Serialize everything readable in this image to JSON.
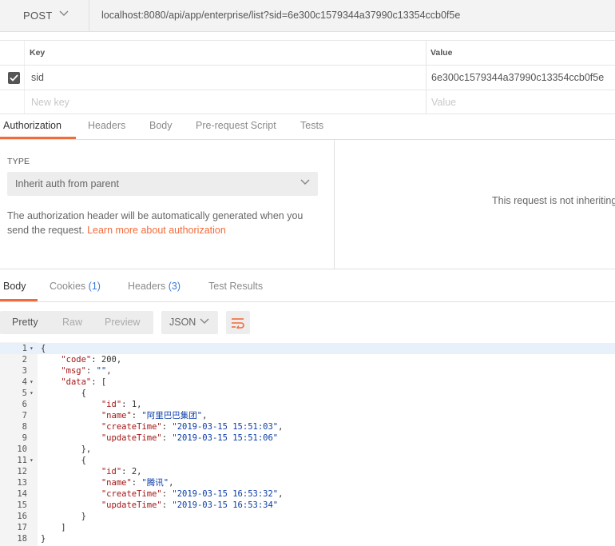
{
  "request": {
    "method": "POST",
    "url": "localhost:8080/api/app/enterprise/list?sid=6e300c1579344a37990c13354ccb0f5e"
  },
  "params": {
    "headers": {
      "key": "Key",
      "value": "Value"
    },
    "rows": [
      {
        "key": "sid",
        "value": "6e300c1579344a37990c13354ccb0f5e",
        "checked": true
      }
    ],
    "new_key_placeholder": "New key",
    "new_value_placeholder": "Value"
  },
  "request_tabs": [
    "Authorization",
    "Headers",
    "Body",
    "Pre-request Script",
    "Tests"
  ],
  "auth": {
    "type_label": "TYPE",
    "type_value": "Inherit auth from parent",
    "description": "The authorization header will be automatically generated when you send the request. ",
    "link_text": "Learn more about authorization",
    "right_message": "This request is not inheriting"
  },
  "response_tabs": {
    "body": "Body",
    "cookies": "Cookies",
    "cookies_count": "(1)",
    "headers": "Headers",
    "headers_count": "(3)",
    "test_results": "Test Results"
  },
  "view_modes": [
    "Pretty",
    "Raw",
    "Preview"
  ],
  "format": "JSON",
  "code_lines": [
    {
      "n": "1",
      "fold": true,
      "text": "{"
    },
    {
      "n": "2",
      "text": "    \"code\": 200,"
    },
    {
      "n": "3",
      "text": "    \"msg\": \"\","
    },
    {
      "n": "4",
      "fold": true,
      "text": "    \"data\": ["
    },
    {
      "n": "5",
      "fold": true,
      "text": "        {"
    },
    {
      "n": "6",
      "text": "            \"id\": 1,"
    },
    {
      "n": "7",
      "text": "            \"name\": \"阿里巴巴集团\","
    },
    {
      "n": "8",
      "text": "            \"createTime\": \"2019-03-15 15:51:03\","
    },
    {
      "n": "9",
      "text": "            \"updateTime\": \"2019-03-15 15:51:06\""
    },
    {
      "n": "10",
      "text": "        },"
    },
    {
      "n": "11",
      "fold": true,
      "text": "        {"
    },
    {
      "n": "12",
      "text": "            \"id\": 2,"
    },
    {
      "n": "13",
      "text": "            \"name\": \"腾讯\","
    },
    {
      "n": "14",
      "text": "            \"createTime\": \"2019-03-15 16:53:32\","
    },
    {
      "n": "15",
      "text": "            \"updateTime\": \"2019-03-15 16:53:34\""
    },
    {
      "n": "16",
      "text": "        }"
    },
    {
      "n": "17",
      "text": "    ]"
    },
    {
      "n": "18",
      "text": "}"
    }
  ],
  "colors": {
    "accent": "#f26b3a",
    "count": "#3a7bd5"
  }
}
